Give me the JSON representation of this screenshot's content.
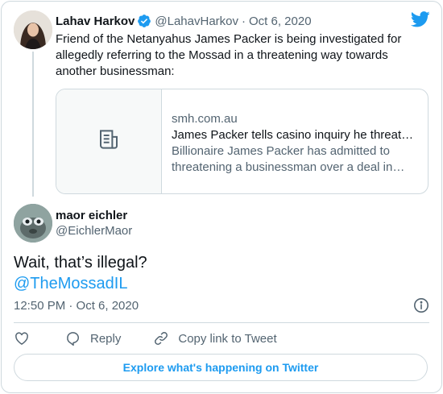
{
  "parent_tweet": {
    "author_name": "Lahav Harkov",
    "author_handle": "@LahavHarkov",
    "separator": "·",
    "date": "Oct 6, 2020",
    "text": "Friend of the Netanyahus James Packer is being investigated for allegedly referring to the Mossad in a threatening way towards another businessman:",
    "link_card": {
      "domain": "smh.com.au",
      "title": "James Packer tells casino inquiry he threatened businessman",
      "description": "Billionaire James Packer has admitted to threatening a businessman over a deal in Macau."
    }
  },
  "main_tweet": {
    "author_name": "maor eichler",
    "author_handle": "@EichlerMaor",
    "text": "Wait, that’s illegal?",
    "mention": "@TheMossadIL",
    "timestamp": "12:50 PM · Oct 6, 2020"
  },
  "actions": {
    "reply_label": "Reply",
    "copy_link_label": "Copy link to Tweet"
  },
  "explore_label": "Explore what's happening on Twitter",
  "colors": {
    "accent": "#1d9bf0",
    "text_primary": "#0f1419",
    "text_secondary": "#536471",
    "border": "#cfd9de"
  }
}
